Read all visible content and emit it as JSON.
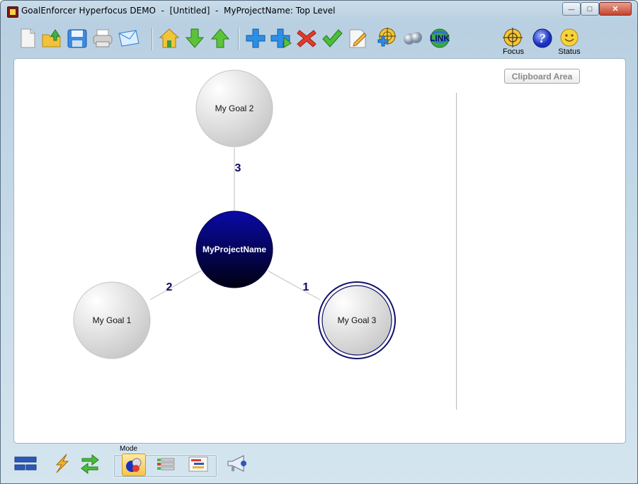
{
  "window": {
    "title": "GoalEnforcer Hyperfocus DEMO  -  [Untitled]  -  MyProjectName: Top Level",
    "minimize_label": "—",
    "maximize_label": "□",
    "close_label": "✕"
  },
  "toolbar": {
    "focus_label": "Focus",
    "status_label": "Status",
    "link_label": "LINK"
  },
  "canvas": {
    "clipboard_label": "Clipboard Area"
  },
  "mindmap": {
    "center": {
      "label": "MyProjectName",
      "color": "#0a0a8c"
    },
    "goals": [
      {
        "label": "My Goal 2",
        "number": "3"
      },
      {
        "label": "My Goal 1",
        "number": "2"
      },
      {
        "label": "My Goal 3",
        "number": "1"
      }
    ]
  },
  "bottombar": {
    "mode_label": "Mode"
  },
  "colors": {
    "accent_blue": "#1a6fd6",
    "node_dark": "#000066",
    "selected_ring": "#101070"
  }
}
